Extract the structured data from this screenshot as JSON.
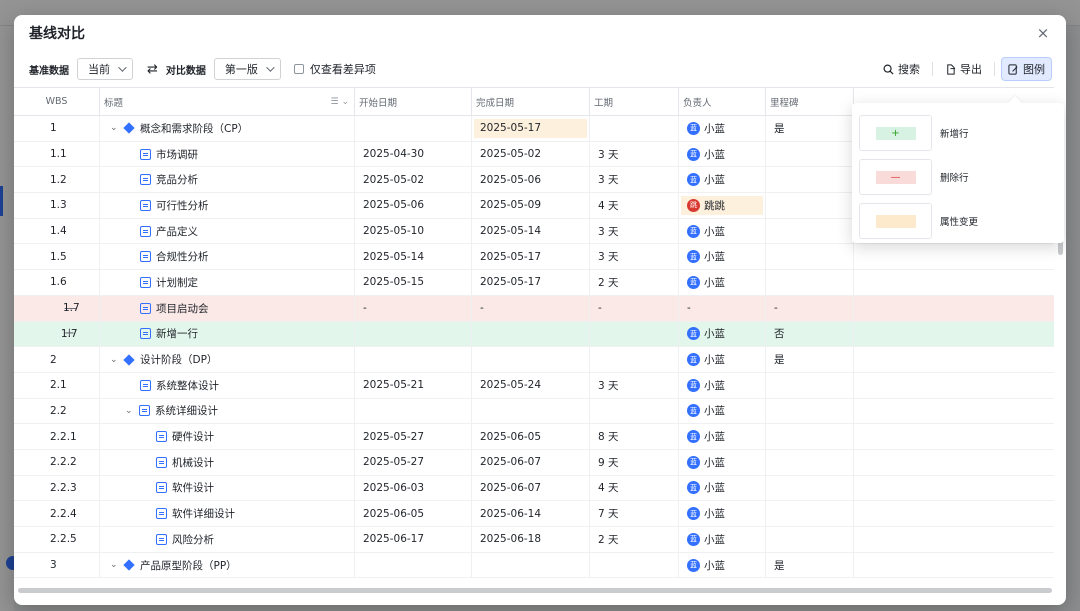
{
  "modal": {
    "title": "基线对比",
    "close_label": "×"
  },
  "toolbar": {
    "base_label": "基准数据",
    "base_value": "当前",
    "compare_label": "对比数据",
    "compare_value": "第一版",
    "diff_only_label": "仅查看差异项",
    "search_label": "搜索",
    "export_label": "导出",
    "legend_label": "图例"
  },
  "columns": {
    "wbs": "WBS",
    "title": "标题",
    "start": "开始日期",
    "end": "完成日期",
    "duration": "工期",
    "owner": "负责人",
    "milestone": "里程碑"
  },
  "rows": [
    {
      "wbs": "1",
      "title": "概念和需求阶段（CP）",
      "kind": "phase",
      "level": 0,
      "start": "",
      "end": "2025-05-17",
      "end_changed": true,
      "duration": "",
      "owner": "小蓝",
      "owner_avatar": "蓝",
      "milestone": "是",
      "state": ""
    },
    {
      "wbs": "1.1",
      "title": "市场调研",
      "kind": "task",
      "level": 1,
      "start": "2025-04-30",
      "end": "2025-05-02",
      "duration": "3 天",
      "owner": "小蓝",
      "owner_avatar": "蓝",
      "milestone": "",
      "state": ""
    },
    {
      "wbs": "1.2",
      "title": "竞品分析",
      "kind": "task",
      "level": 1,
      "start": "2025-05-02",
      "end": "2025-05-06",
      "duration": "3 天",
      "owner": "小蓝",
      "owner_avatar": "蓝",
      "milestone": "",
      "state": ""
    },
    {
      "wbs": "1.3",
      "title": "可行性分析",
      "kind": "task",
      "level": 1,
      "start": "2025-05-06",
      "end": "2025-05-09",
      "duration": "4 天",
      "owner": "跳跳",
      "owner_avatar": "跳",
      "owner_changed": true,
      "milestone": "",
      "state": ""
    },
    {
      "wbs": "1.4",
      "title": "产品定义",
      "kind": "task",
      "level": 1,
      "start": "2025-05-10",
      "end": "2025-05-14",
      "duration": "3 天",
      "owner": "小蓝",
      "owner_avatar": "蓝",
      "milestone": "",
      "state": ""
    },
    {
      "wbs": "1.5",
      "title": "合规性分析",
      "kind": "task",
      "level": 1,
      "start": "2025-05-14",
      "end": "2025-05-17",
      "duration": "3 天",
      "owner": "小蓝",
      "owner_avatar": "蓝",
      "milestone": "",
      "state": ""
    },
    {
      "wbs": "1.6",
      "title": "计划制定",
      "kind": "task",
      "level": 1,
      "start": "2025-05-15",
      "end": "2025-05-17",
      "duration": "2 天",
      "owner": "小蓝",
      "owner_avatar": "蓝",
      "milestone": "",
      "state": ""
    },
    {
      "wbs": "1.7",
      "title": "项目启动会",
      "kind": "task",
      "level": 1,
      "start": "-",
      "end": "-",
      "duration": "-",
      "owner": "-",
      "owner_avatar": "",
      "milestone": "-",
      "state": "del",
      "state_mark": "—"
    },
    {
      "wbs": "1.7",
      "title": "新增一行",
      "kind": "task",
      "level": 1,
      "start": "",
      "end": "",
      "duration": "",
      "owner": "小蓝",
      "owner_avatar": "蓝",
      "milestone": "否",
      "state": "add",
      "state_mark": "+"
    },
    {
      "wbs": "2",
      "title": "设计阶段（DP）",
      "kind": "phase",
      "level": 0,
      "start": "",
      "end": "",
      "duration": "",
      "owner": "小蓝",
      "owner_avatar": "蓝",
      "milestone": "是",
      "state": ""
    },
    {
      "wbs": "2.1",
      "title": "系统整体设计",
      "kind": "task",
      "level": 1,
      "start": "2025-05-21",
      "end": "2025-05-24",
      "duration": "3 天",
      "owner": "小蓝",
      "owner_avatar": "蓝",
      "milestone": "",
      "state": ""
    },
    {
      "wbs": "2.2",
      "title": "系统详细设计",
      "kind": "group",
      "level": 1,
      "start": "",
      "end": "",
      "duration": "",
      "owner": "小蓝",
      "owner_avatar": "蓝",
      "milestone": "",
      "state": ""
    },
    {
      "wbs": "2.2.1",
      "title": "硬件设计",
      "kind": "task",
      "level": 2,
      "start": "2025-05-27",
      "end": "2025-06-05",
      "duration": "8 天",
      "owner": "小蓝",
      "owner_avatar": "蓝",
      "milestone": "",
      "state": ""
    },
    {
      "wbs": "2.2.2",
      "title": "机械设计",
      "kind": "task",
      "level": 2,
      "start": "2025-05-27",
      "end": "2025-06-07",
      "duration": "9 天",
      "owner": "小蓝",
      "owner_avatar": "蓝",
      "milestone": "",
      "state": ""
    },
    {
      "wbs": "2.2.3",
      "title": "软件设计",
      "kind": "task",
      "level": 2,
      "start": "2025-06-03",
      "end": "2025-06-07",
      "duration": "4 天",
      "owner": "小蓝",
      "owner_avatar": "蓝",
      "milestone": "",
      "state": ""
    },
    {
      "wbs": "2.2.4",
      "title": "软件详细设计",
      "kind": "task",
      "level": 2,
      "start": "2025-06-05",
      "end": "2025-06-14",
      "duration": "7 天",
      "owner": "小蓝",
      "owner_avatar": "蓝",
      "milestone": "",
      "state": ""
    },
    {
      "wbs": "2.2.5",
      "title": "风险分析",
      "kind": "task",
      "level": 2,
      "start": "2025-06-17",
      "end": "2025-06-18",
      "duration": "2 天",
      "owner": "小蓝",
      "owner_avatar": "蓝",
      "milestone": "",
      "state": ""
    },
    {
      "wbs": "3",
      "title": "产品原型阶段（PP）",
      "kind": "phase",
      "level": 0,
      "start": "",
      "end": "",
      "duration": "",
      "owner": "小蓝",
      "owner_avatar": "蓝",
      "milestone": "是",
      "state": ""
    }
  ],
  "legend": {
    "items": [
      {
        "label": "新增行",
        "symbol": "+",
        "style": "add"
      },
      {
        "label": "删除行",
        "symbol": "—",
        "style": "del"
      },
      {
        "label": "属性变更",
        "symbol": "",
        "style": "mod"
      }
    ]
  },
  "colors": {
    "accent": "#3370ff",
    "added_row": "#e3f6ec",
    "deleted_row": "#fbe9e8",
    "changed_cell": "#fdf0dc"
  }
}
